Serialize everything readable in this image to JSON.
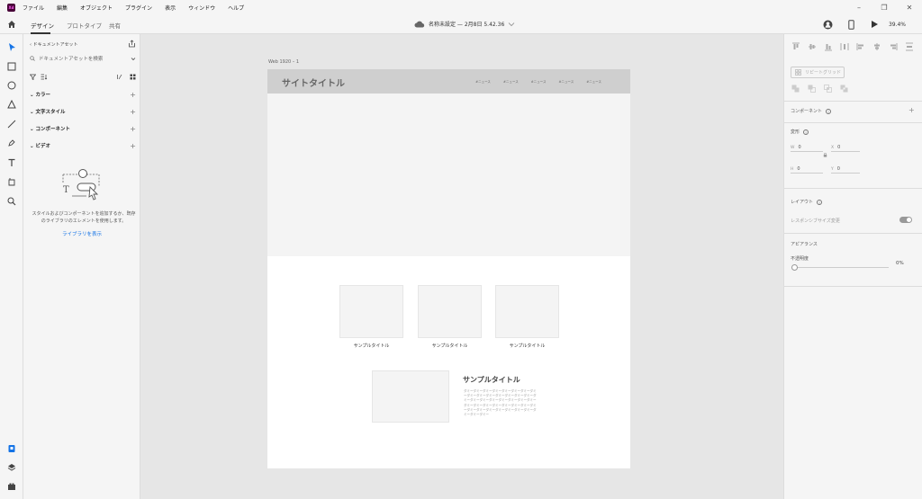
{
  "app": {
    "logo": "Xd",
    "accent": "#1473e6"
  },
  "menu": [
    "ファイル",
    "編集",
    "オブジェクト",
    "プラグイン",
    "表示",
    "ウィンドウ",
    "ヘルプ"
  ],
  "window_controls": [
    "–",
    "❐",
    "✕"
  ],
  "toolbar": {
    "tabs": [
      "デザイン",
      "プロトタイプ",
      "共有"
    ],
    "document_status": "名称未設定 — 2月8日 5.42.36",
    "zoom": "39.4%"
  },
  "assets": {
    "back_label": "ドキュメントアセット",
    "search_placeholder": "ドキュメントアセットを検索",
    "sections": [
      "カラー",
      "文字スタイル",
      "コンポーネント",
      "ビデオ"
    ],
    "empty_message": "スタイルおよびコンポーネントを追加するか、既存のライブラリのエレメントを使用します。",
    "library_link": "ライブラリを表示"
  },
  "artboard": {
    "label": "Web 1920 – 1",
    "site_title": "サイトタイトル",
    "nav": [
      "#ニュース",
      "#ニュース",
      "#ニュース",
      "#ニュース",
      "#ニュース"
    ],
    "cards": [
      {
        "title": "サンプルタイトル"
      },
      {
        "title": "サンプルタイトル"
      },
      {
        "title": "サンプルタイトル"
      }
    ],
    "feature_title": "サンプルタイトル",
    "feature_body": "ダミーダミーダミーダミーダミーダミーダミーダミーダミーダミーダミーダミーダミーダミーダミーダミーダミーダミーダミーダミーダミーダミーダミーダミーダミーダミーダミーダミーダミーダミーダミーダミーダミーダミーダミーダミーダミーダミーダミーダミーダミー"
  },
  "properties": {
    "repeat_grid": "リピートグリッド",
    "component_label": "コンポーネント",
    "transform_label": "変形",
    "w_label": "W",
    "w_value": "0",
    "x_label": "X",
    "x_value": "0",
    "h_label": "H",
    "h_value": "0",
    "y_label": "Y",
    "y_value": "0",
    "layout_label": "レイアウト",
    "responsive_label": "レスポンシブサイズ変更",
    "appearance_label": "アピアランス",
    "opacity_label": "不透明度",
    "opacity_value": "0%"
  }
}
